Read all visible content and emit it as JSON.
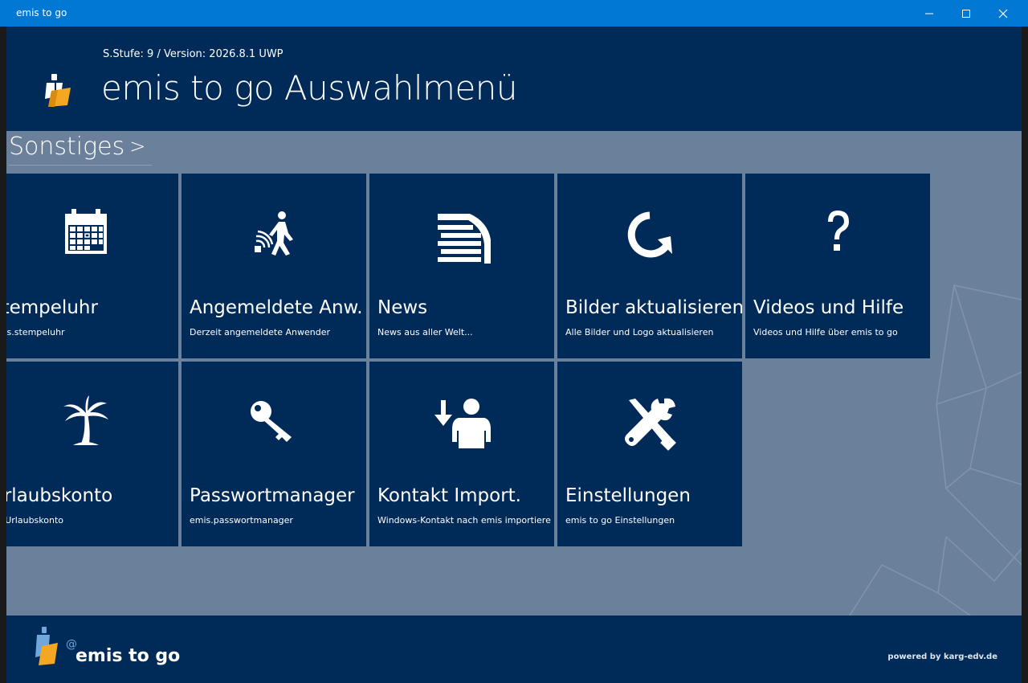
{
  "window": {
    "title": "emis to go"
  },
  "header": {
    "version": "S.Stufe: 9 / Version: 2026.8.1 UWP",
    "title": "emis to go Auswahlmenü"
  },
  "section": {
    "label": "Sonstiges"
  },
  "tiles": [
    {
      "title": "Stempeluhr",
      "subtitle": "emis.stempeluhr",
      "icon": "calendar-icon"
    },
    {
      "title": "Angemeldete Anw.",
      "subtitle": "Derzeit angemeldete Anwender",
      "icon": "walking-person-icon"
    },
    {
      "title": "News",
      "subtitle": "News aus aller Welt...",
      "icon": "news-icon"
    },
    {
      "title": "Bilder aktualisieren",
      "subtitle": "Alle Bilder und Logo aktualisieren",
      "icon": "refresh-icon"
    },
    {
      "title": "Videos und Hilfe",
      "subtitle": "Videos und Hilfe über emis to go",
      "icon": "question-mark-icon"
    },
    {
      "title": "Urlaubskonto",
      "subtitle": "Ihr Urlaubskonto",
      "icon": "palm-tree-icon"
    },
    {
      "title": "Passwortmanager",
      "subtitle": "emis.passwortmanager",
      "icon": "key-icon"
    },
    {
      "title": "Kontakt Import.",
      "subtitle": "Windows-Kontakt nach emis importiere",
      "icon": "contact-import-icon"
    },
    {
      "title": "Einstellungen",
      "subtitle": "emis to go Einstellungen",
      "icon": "tools-icon"
    }
  ],
  "footer": {
    "logo_text": "emis to go",
    "powered": "powered by karg-edv.de"
  },
  "colors": {
    "titlebar": "#0078d4",
    "header": "#002a58",
    "tile": "#002a58",
    "content_bg": "#6b819b",
    "logo_orange": "#f5a623"
  }
}
